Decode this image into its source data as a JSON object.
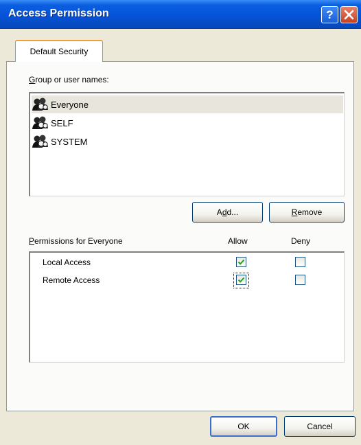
{
  "window": {
    "title": "Access Permission",
    "help_glyph": "?",
    "close_icon": "close-x-icon",
    "titlebar_color": "#0553d8"
  },
  "tabs": [
    {
      "label": "Default Security",
      "active": true
    }
  ],
  "users_section": {
    "label_prefix": "G",
    "label_rest": "roup or user names:",
    "items": [
      {
        "name": "Everyone",
        "icon": "user-group-icon",
        "selected": true
      },
      {
        "name": "SELF",
        "icon": "user-group-icon",
        "selected": false
      },
      {
        "name": "SYSTEM",
        "icon": "user-group-icon",
        "selected": false
      }
    ],
    "add_button": {
      "pre": "A",
      "accel": "d",
      "post": "d..."
    },
    "remove_button": {
      "accel": "R",
      "post": "emove"
    }
  },
  "permissions": {
    "label_accel": "P",
    "label_rest": "ermissions for Everyone",
    "col_allow": "Allow",
    "col_deny": "Deny",
    "rows": [
      {
        "name": "Local Access",
        "allow": true,
        "deny": false
      },
      {
        "name": "Remote Access",
        "allow": true,
        "deny": false
      }
    ]
  },
  "buttons": {
    "ok": "OK",
    "cancel": "Cancel"
  }
}
